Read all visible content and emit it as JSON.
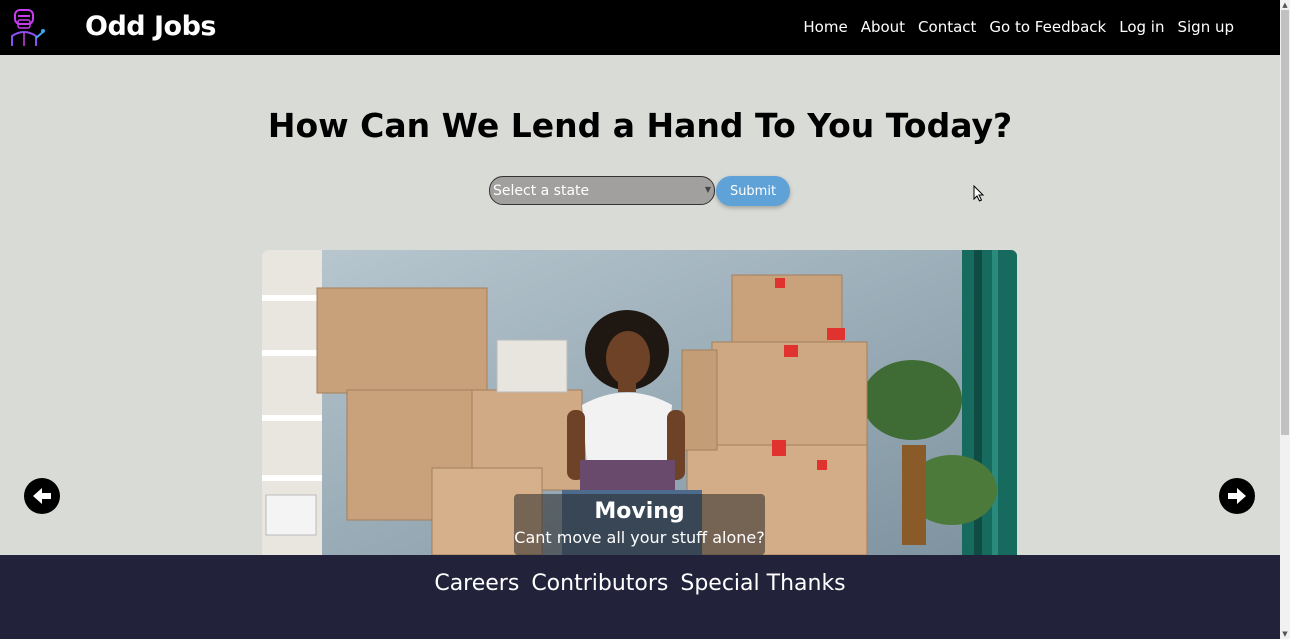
{
  "navbar": {
    "brand": "Odd Jobs",
    "links": [
      "Home",
      "About",
      "Contact",
      "Go to Feedback",
      "Log in",
      "Sign up"
    ]
  },
  "main": {
    "headline": "How Can We Lend a Hand To You Today?",
    "state_select": {
      "value": "Select a state"
    },
    "submit_label": "Submit"
  },
  "carousel": {
    "caption_title": "Moving",
    "caption_subtitle": "Cant move all your stuff alone?"
  },
  "footer": {
    "links": [
      "Careers",
      "Contributors",
      "Special Thanks"
    ]
  },
  "colors": {
    "navbar_bg": "#000000",
    "page_bg": "#d9dbd6",
    "footer_bg": "#22223a",
    "submit_bg": "#5ea2d7",
    "select_bg": "#a2a09f"
  }
}
